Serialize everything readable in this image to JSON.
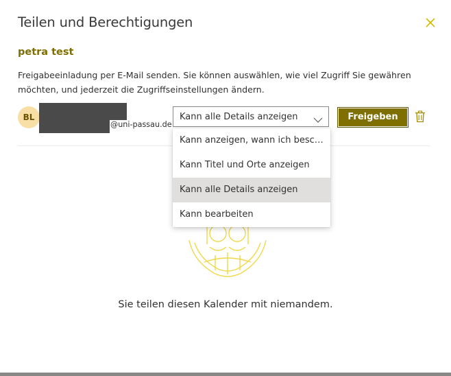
{
  "dialog": {
    "title": "Teilen und Berechtigungen",
    "calendar_name": "petra test",
    "description": "Freigabeeinladung per E-Mail senden. Sie können auswählen, wie viel Zugriff Sie gewähren möchten, und jederzeit die Zugriffseinstellungen ändern.",
    "close_icon": "close-icon"
  },
  "invitee": {
    "initials": "BL",
    "email_suffix": "@uni-passau.de",
    "permission_selected": "Kann alle Details anzeigen"
  },
  "actions": {
    "share_label": "Freigeben",
    "delete_icon": "trash-icon"
  },
  "permission_menu": {
    "items": [
      "Kann anzeigen, wann ich beschä…",
      "Kann Titel und Orte anzeigen",
      "Kann alle Details anzeigen",
      "Kann bearbeiten"
    ],
    "selected_index": 2
  },
  "empty_state": {
    "message": "Sie teilen diesen Kalender mit niemandem."
  },
  "colors": {
    "accent": "#7f6e00",
    "accent_light": "#f4e44a",
    "avatar_bg": "#f7dfa5",
    "selected_bg": "#e1dfdd"
  }
}
